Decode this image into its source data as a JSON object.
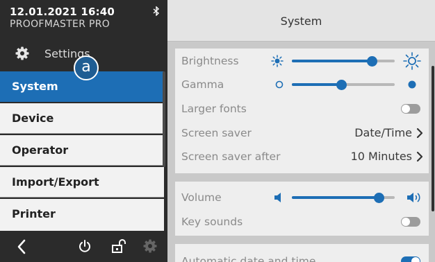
{
  "status": {
    "datetime": "12.01.2021 16:40",
    "device": "PROOFMASTER PRO",
    "bluetooth_icon": "bluetooth-icon"
  },
  "sidebar": {
    "settings_label": "Settings",
    "marker_label": "a",
    "items": [
      {
        "label": "System",
        "active": true
      },
      {
        "label": "Device"
      },
      {
        "label": "Operator"
      },
      {
        "label": "Import/Export"
      },
      {
        "label": "Printer"
      }
    ],
    "bottom_icons": [
      "back-icon",
      "power-icon",
      "unlock-icon",
      "gear-icon"
    ]
  },
  "main": {
    "title": "System",
    "display": {
      "brightness": {
        "label": "Brightness",
        "value": 0.78
      },
      "gamma": {
        "label": "Gamma",
        "value": 0.48
      },
      "larger_fonts": {
        "label": "Larger fonts",
        "on": false
      },
      "screen_saver": {
        "label": "Screen saver",
        "value": "Date/Time"
      },
      "screen_saver_after": {
        "label": "Screen saver after",
        "value": "10 Minutes"
      }
    },
    "sound": {
      "volume": {
        "label": "Volume",
        "value": 0.85
      },
      "key_sounds": {
        "label": "Key sounds",
        "on": false
      }
    },
    "datetime": {
      "automatic": {
        "label": "Automatic date and time",
        "on": true
      }
    }
  },
  "colors": {
    "accent": "#1d6eb5",
    "sidebar_bg": "#2b2b2b",
    "panel_bg": "#eeeeee"
  }
}
